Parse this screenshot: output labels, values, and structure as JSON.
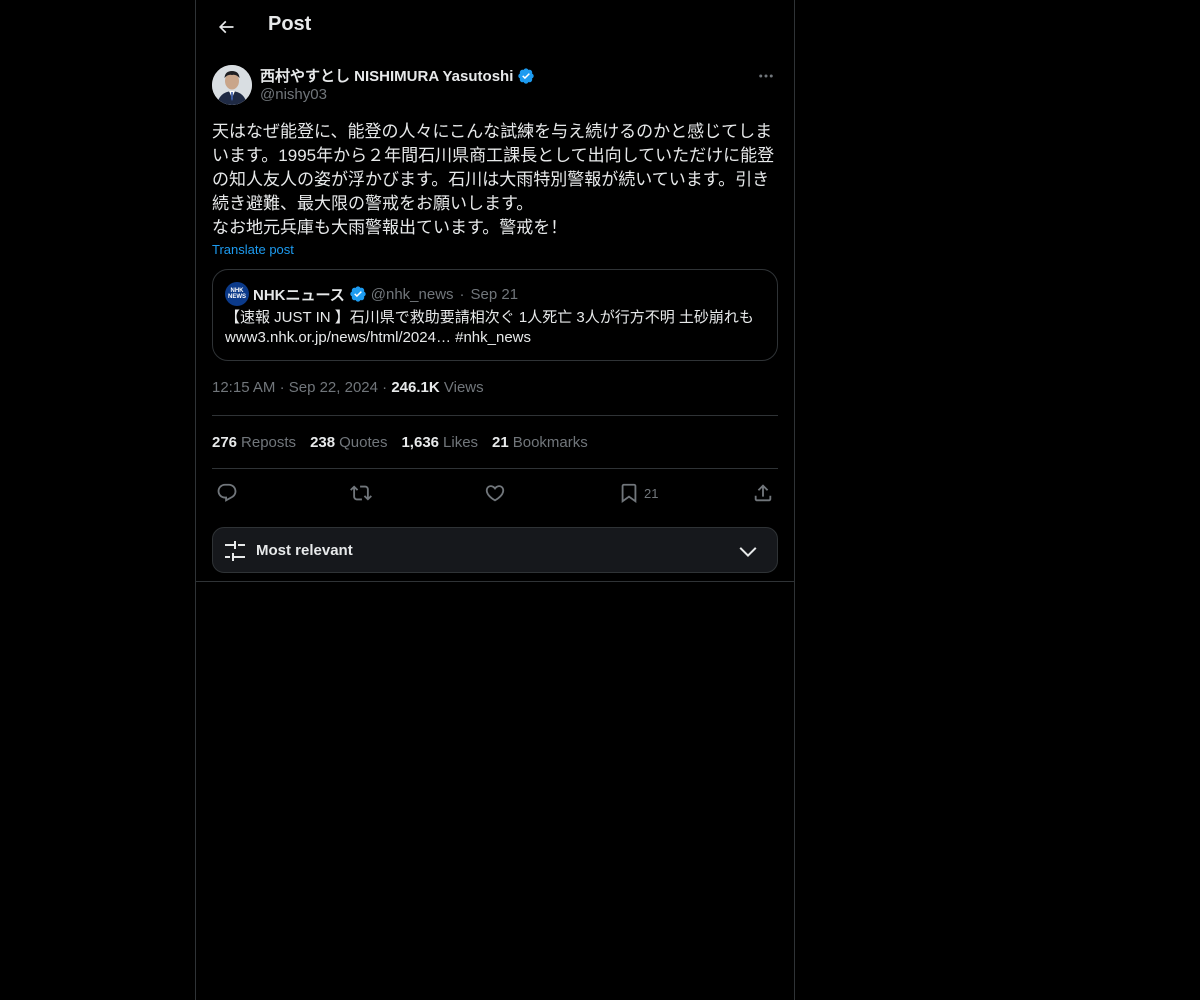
{
  "header": {
    "title": "Post"
  },
  "post": {
    "author_name": "西村やすとし NISHIMURA Yasutoshi",
    "author_handle": "@nishy03",
    "text": "天はなぜ能登に、能登の人々にこんな試練を与え続けるのかと感じてしまいます。1995年から２年間石川県商工課長として出向していただけに能登の知人友人の姿が浮かびます。石川は大雨特別警報が続いています。引き続き避難、最大限の警戒をお願いします。\nなお地元兵庫も大雨警報出ています。警戒を！",
    "translate_label": "Translate post",
    "time": "12:15 AM",
    "date": "Sep 22, 2024",
    "views_count": "246.1K",
    "views_label": "Views"
  },
  "quote": {
    "avatar_text_top": "NHK",
    "avatar_text_bottom": "NEWS",
    "name": "NHKニュース",
    "handle": "@nhk_news",
    "date": "Sep 21",
    "text_line1": "【速報 JUST IN 】石川県で救助要請相次ぐ 1人死亡 3人が行方不明 土砂崩れも",
    "text_line2": "www3.nhk.or.jp/news/html/2024… #nhk_news"
  },
  "stats": [
    {
      "num": "276",
      "label": "Reposts"
    },
    {
      "num": "238",
      "label": "Quotes"
    },
    {
      "num": "1,636",
      "label": "Likes"
    },
    {
      "num": "21",
      "label": "Bookmarks"
    }
  ],
  "actions": {
    "bookmark_count": "21"
  },
  "sort": {
    "label": "Most relevant"
  },
  "colors": {
    "background": "#000000",
    "border": "#2f3336",
    "text_primary": "#e7e9ea",
    "text_secondary": "#71767b",
    "accent": "#1d9bf0"
  },
  "icons": [
    "back-arrow-icon",
    "verified-badge-icon",
    "more-icon",
    "reply-icon",
    "repost-icon",
    "like-icon",
    "bookmark-icon",
    "share-icon",
    "sort-sliders-icon",
    "chevron-down-icon"
  ]
}
